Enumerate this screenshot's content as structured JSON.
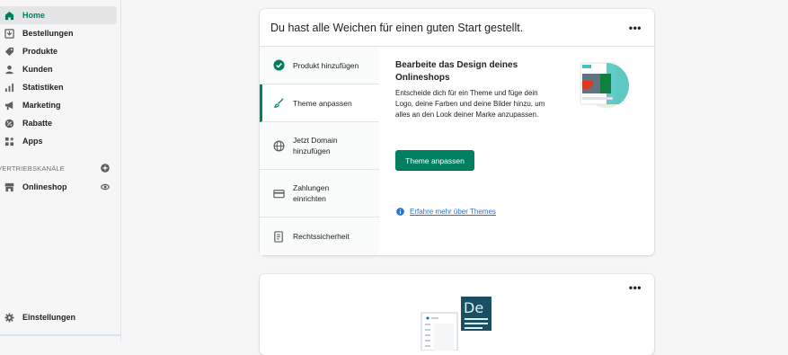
{
  "sidebar": {
    "items": [
      {
        "label": "Home",
        "icon": "home-icon",
        "active": true
      },
      {
        "label": "Bestellungen",
        "icon": "orders-icon"
      },
      {
        "label": "Produkte",
        "icon": "tag-icon"
      },
      {
        "label": "Kunden",
        "icon": "person-icon"
      },
      {
        "label": "Statistiken",
        "icon": "bar-chart-icon"
      },
      {
        "label": "Marketing",
        "icon": "megaphone-icon"
      },
      {
        "label": "Rabatte",
        "icon": "discount-icon"
      },
      {
        "label": "Apps",
        "icon": "apps-icon"
      }
    ],
    "section_label": "VERTRIEBSKANÄLE",
    "channel": {
      "label": "Onlineshop",
      "icon": "store-icon"
    },
    "settings": {
      "label": "Einstellungen",
      "icon": "gear-icon"
    }
  },
  "setup_card": {
    "title": "Du hast alle Weichen für einen guten Start gestellt.",
    "menu": "•••",
    "tabs": [
      {
        "label": "Produkt hinzufügen",
        "icon": "check-circle-icon",
        "completed": true
      },
      {
        "label": "Theme anpassen",
        "icon": "brush-icon",
        "selected": true
      },
      {
        "label": "Jetzt Domain hinzufügen",
        "icon": "globe-icon"
      },
      {
        "label": "Zahlungen einrichten",
        "icon": "credit-card-icon"
      },
      {
        "label": "Rechtssicherheit",
        "icon": "document-icon"
      }
    ],
    "content": {
      "title": "Bearbeite das Design deines Onlineshops",
      "text": "Entscheide dich für ein Theme und füge dein Logo, deine Farben und deine Bilder hinzu, um alles an den Look deiner Marke anzupassen.",
      "button": "Theme anpassen",
      "link": "Erfahre mehr über Themes"
    }
  },
  "second_card": {
    "menu": "•••",
    "badge": "De"
  },
  "colors": {
    "accent": "#008060",
    "active_nav_text": "#007f5f",
    "link": "#2c6ecb"
  }
}
